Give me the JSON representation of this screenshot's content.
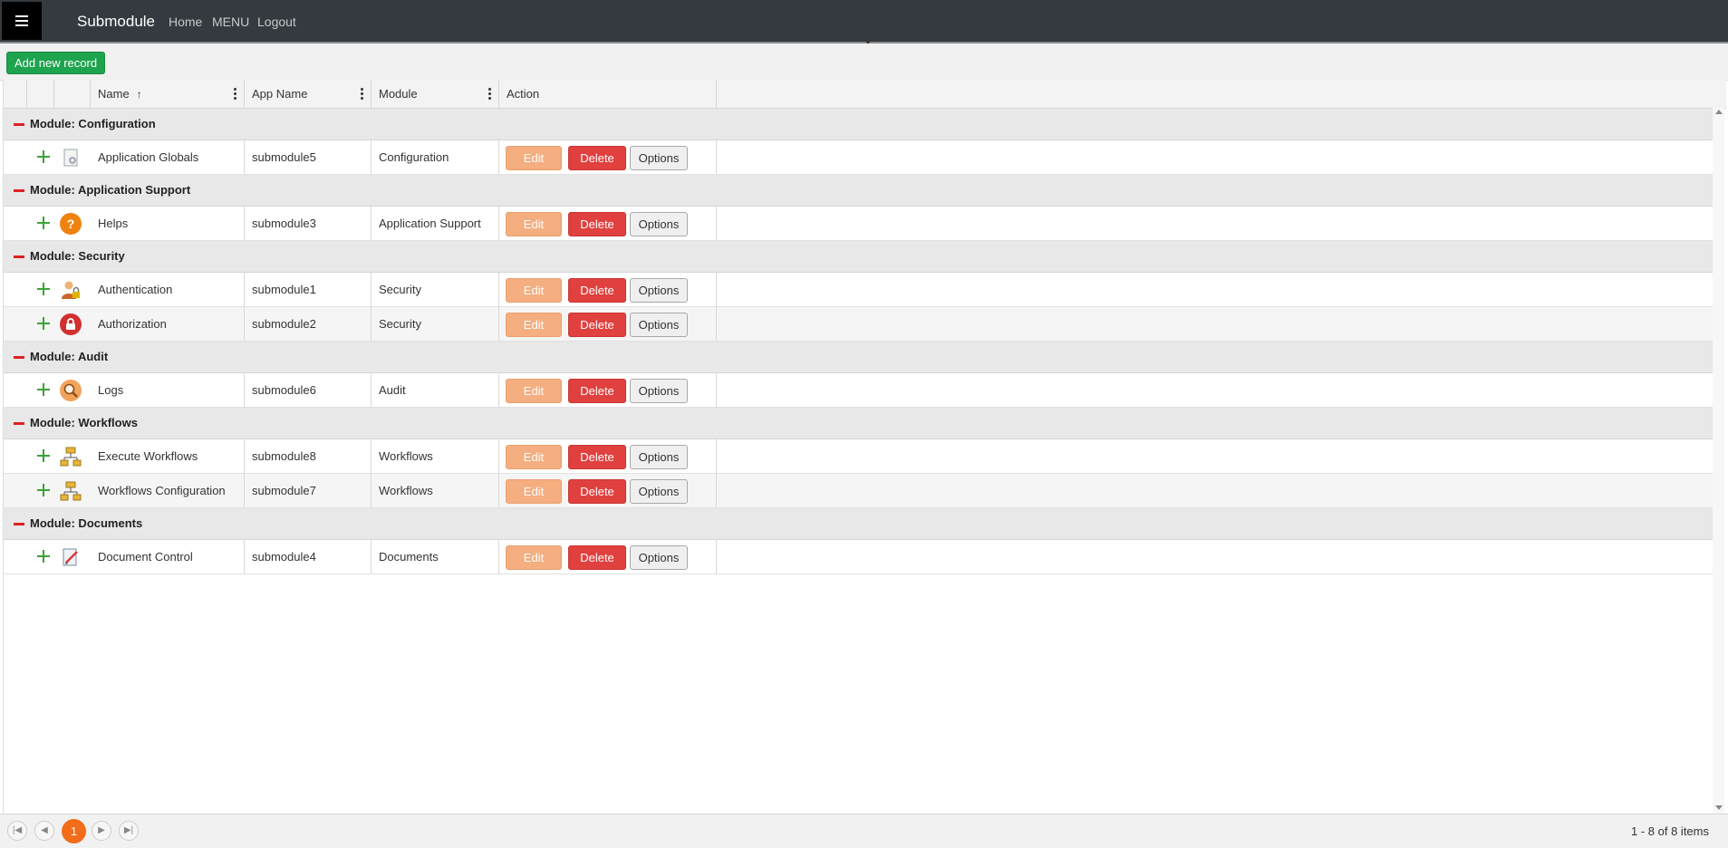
{
  "nav": {
    "brand": "Submodule",
    "links": [
      "Home",
      "MENU",
      "Logout"
    ]
  },
  "toolbar": {
    "add_label": "Add new record"
  },
  "columns": {
    "name": "Name",
    "app_name": "App Name",
    "module": "Module",
    "action": "Action",
    "sort_icon": "↑"
  },
  "groups": [
    {
      "title": "Module: Configuration",
      "rows": [
        {
          "name": "Application Globals",
          "app": "submodule5",
          "module": "Configuration",
          "icon": "gear-document-icon"
        }
      ]
    },
    {
      "title": "Module: Application Support",
      "rows": [
        {
          "name": "Helps",
          "app": "submodule3",
          "module": "Application Support",
          "icon": "help-icon"
        }
      ]
    },
    {
      "title": "Module: Security",
      "rows": [
        {
          "name": "Authentication",
          "app": "submodule1",
          "module": "Security",
          "icon": "user-lock-icon"
        },
        {
          "name": "Authorization",
          "app": "submodule2",
          "module": "Security",
          "icon": "padlock-icon"
        }
      ]
    },
    {
      "title": "Module: Audit",
      "rows": [
        {
          "name": "Logs",
          "app": "submodule6",
          "module": "Audit",
          "icon": "magnifier-icon"
        }
      ]
    },
    {
      "title": "Module: Workflows",
      "rows": [
        {
          "name": "Execute Workflows",
          "app": "submodule8",
          "module": "Workflows",
          "icon": "workflow-icon"
        },
        {
          "name": "Workflows Configuration",
          "app": "submodule7",
          "module": "Workflows",
          "icon": "workflow-icon"
        }
      ]
    },
    {
      "title": "Module: Documents",
      "rows": [
        {
          "name": "Document Control",
          "app": "submodule4",
          "module": "Documents",
          "icon": "document-edit-icon"
        }
      ]
    }
  ],
  "actions": {
    "edit": "Edit",
    "delete": "Delete",
    "options": "Options"
  },
  "icon_glyphs": {
    "help": "?"
  },
  "pager": {
    "current": "1",
    "info": "1 - 8 of 8 items"
  },
  "colors": {
    "edit": "#f4ae80",
    "delete": "#e0403e",
    "add": "#1ea34e",
    "pager_current": "#f26c1a"
  }
}
